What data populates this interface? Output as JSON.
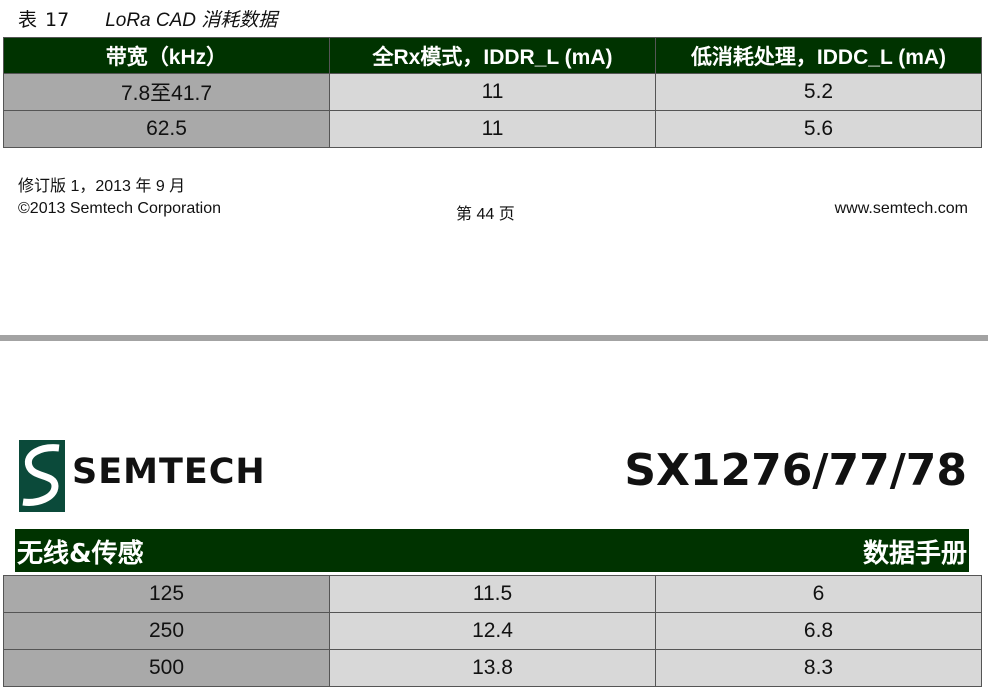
{
  "caption": {
    "label": "表",
    "number": "17",
    "title": "LoRa CAD 消耗数据"
  },
  "table_top": {
    "headers": [
      "带宽（kHz）",
      "全Rx模式，IDDR_L (mA)",
      "低消耗处理，IDDC_L (mA)"
    ],
    "rows": [
      [
        "7.8至41.7",
        "11",
        "5.2"
      ],
      [
        "62.5",
        "11",
        "5.6"
      ]
    ]
  },
  "footer": {
    "revision": "修订版 1，2013 年 9 月",
    "copyright": "©2013 Semtech Corporation",
    "page": "第 44 页",
    "website": "www.semtech.com"
  },
  "header": {
    "logo_text": "SEMTECH",
    "product": "SX1276/77/78",
    "banner_left": "无线&传感",
    "banner_right": "数据手册"
  },
  "table_bottom": {
    "rows": [
      [
        "125",
        "11.5",
        "6"
      ],
      [
        "250",
        "12.4",
        "6.8"
      ],
      [
        "500",
        "13.8",
        "8.3"
      ]
    ]
  },
  "colors": {
    "header_green": "#003300",
    "col1_gray": "#a9a9a9",
    "cell_gray": "#d8d8d8",
    "separator": "#a3a3a3"
  }
}
